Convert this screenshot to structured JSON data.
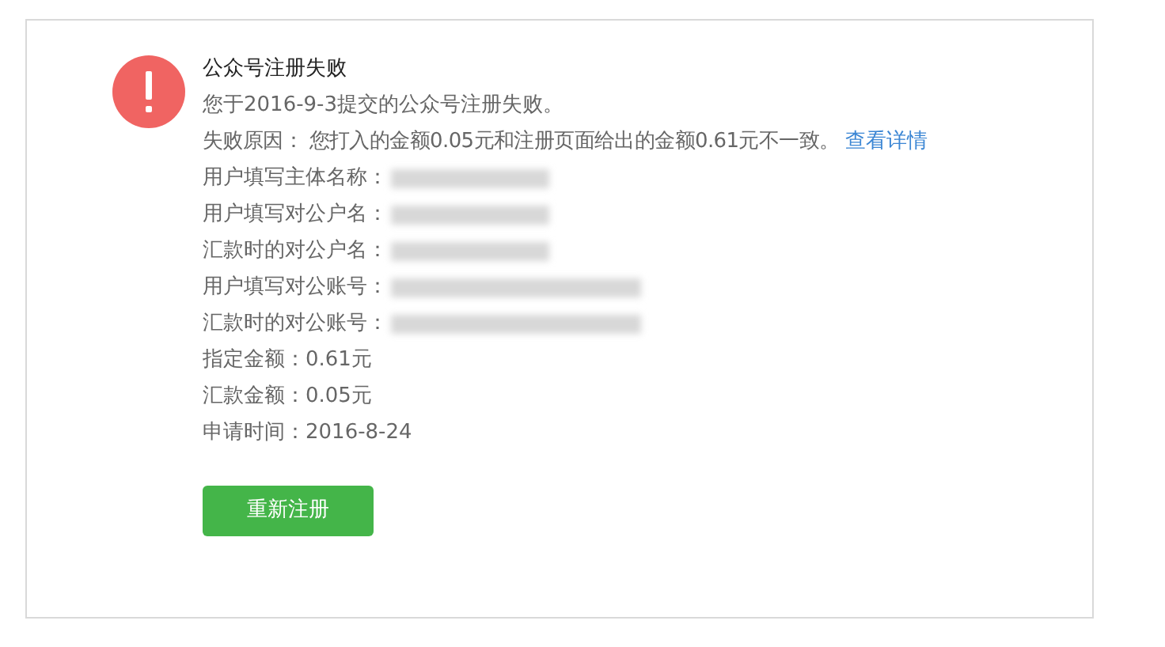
{
  "title": "公众号注册失败",
  "summary": "您于2016-9-3提交的公众号注册失败。",
  "reason": {
    "text": "失败原因： 您打入的金额0.05元和注册页面给出的金额0.61元不一致。",
    "link": "查看详情"
  },
  "fields": [
    {
      "kind": "masked-short",
      "label": "用户填写主体名称："
    },
    {
      "kind": "masked-short",
      "label": "用户填写对公户名："
    },
    {
      "kind": "masked-short",
      "label": "汇款时的对公户名："
    },
    {
      "kind": "masked-long",
      "label": "用户填写对公账号："
    },
    {
      "kind": "masked-long",
      "label": "汇款时的对公账号："
    },
    {
      "kind": "text",
      "label": "指定金额：",
      "value": "0.61元"
    },
    {
      "kind": "text",
      "label": "汇款金额：",
      "value": "0.05元"
    },
    {
      "kind": "text",
      "label": "申请时间：",
      "value": "2016-8-24"
    }
  ],
  "button": "重新注册"
}
